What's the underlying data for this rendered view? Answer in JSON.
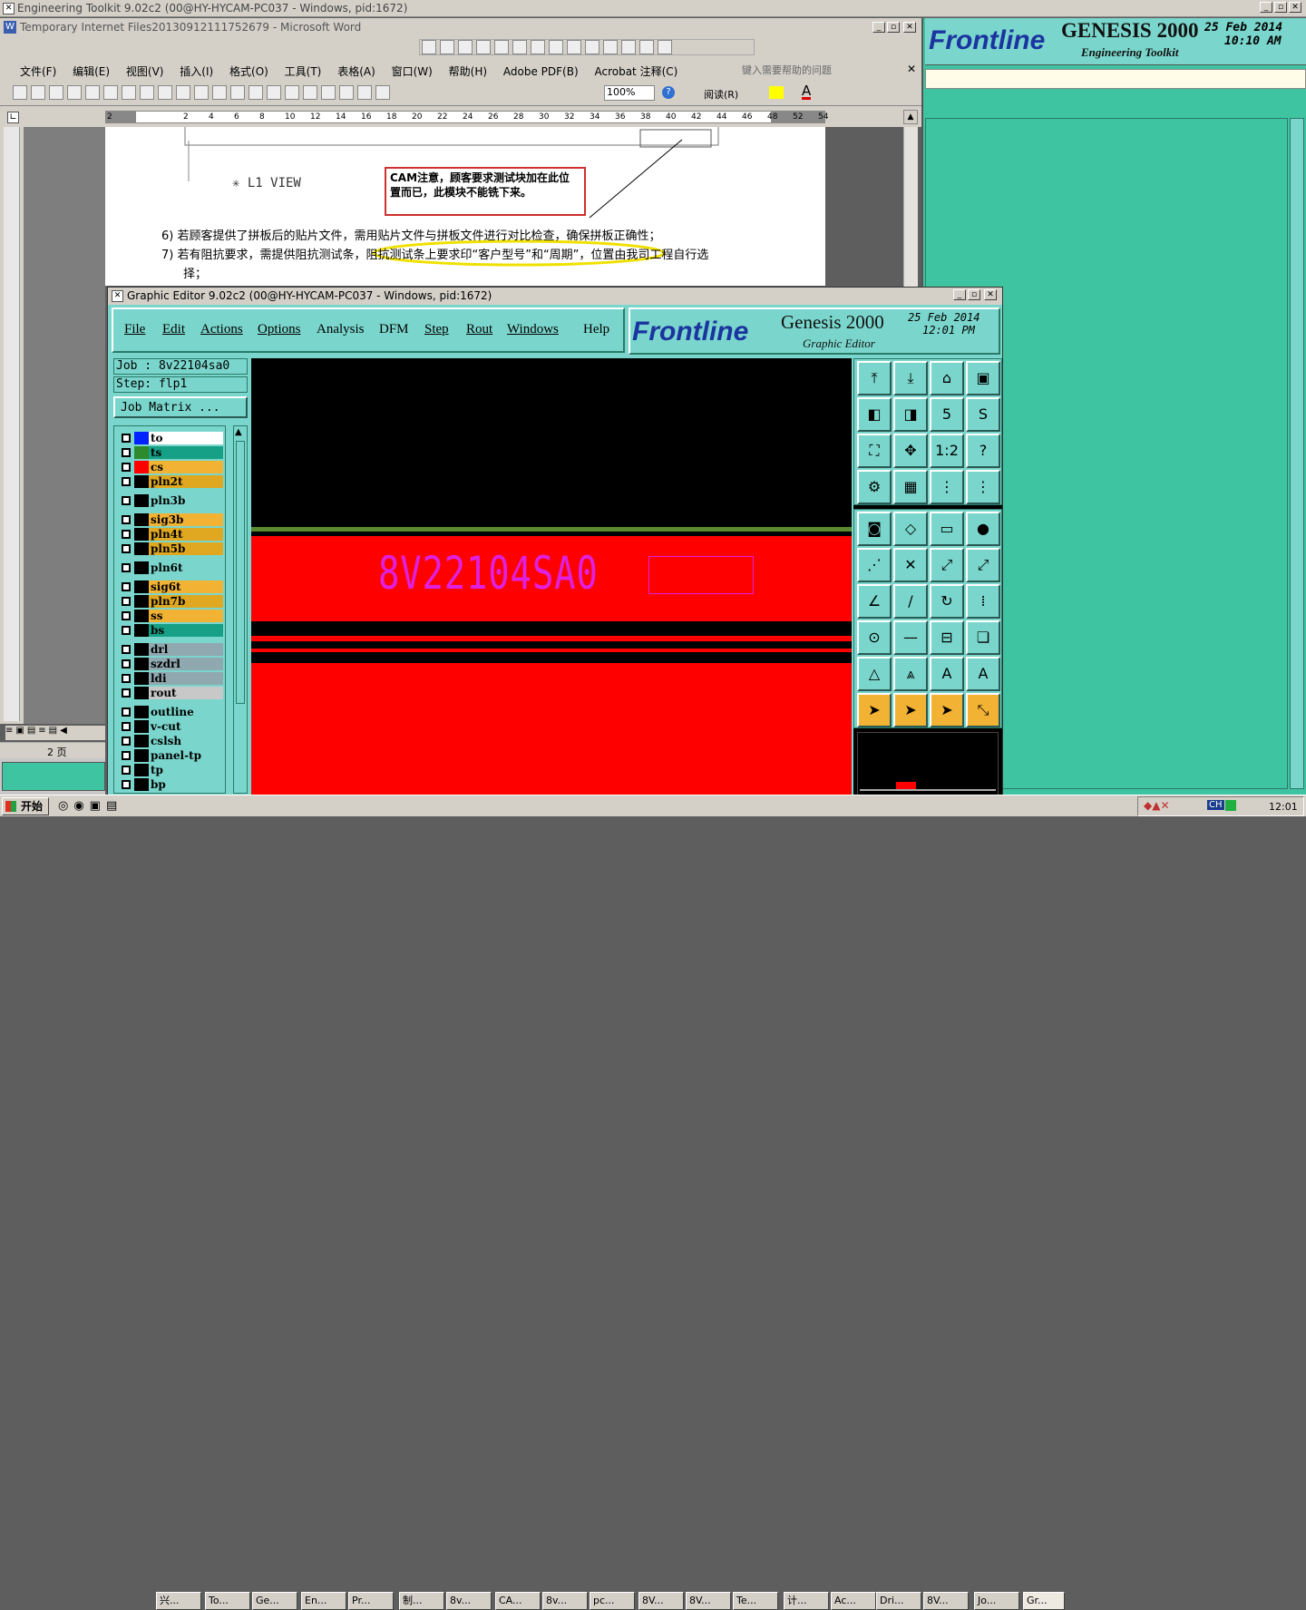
{
  "word": {
    "outer_title": "Engineering Toolkit 9.02c2 (00@HY-HYCAM-PC037 - Windows, pid:1672)",
    "title": "Temporary Internet Files20130912111752679 - Microsoft Word",
    "menus": [
      "文件(F)",
      "编辑(E)",
      "视图(V)",
      "插入(I)",
      "格式(O)",
      "工具(T)",
      "表格(A)",
      "窗口(W)",
      "帮助(H)",
      "Adobe PDF(B)",
      "Acrobat 注释(C)"
    ],
    "help_placeholder": "键入需要帮助的问题",
    "zoom": "100%",
    "read_label": "阅读(R)",
    "ruler": [
      "2",
      "2",
      "4",
      "6",
      "8",
      "10",
      "12",
      "14",
      "16",
      "18",
      "20",
      "22",
      "24",
      "26",
      "28",
      "30",
      "32",
      "34",
      "36",
      "38",
      "40",
      "42",
      "44",
      "46",
      "48",
      "52",
      "54"
    ],
    "l1_view": "✳ L1 VIEW",
    "callout": "CAM注意，顾客要求测试块加在此位置而已，此模块不能铣下来。",
    "item6": "6)  若顾客提供了拼板后的贴片文件，需用贴片文件与拼板文件进行对比检查，确保拼板正确性；",
    "item7a": "7)  若有阻抗要求，需提供阻抗测试条，阻抗测试条上要求印“客户型号”和“周期”，位置由我司工程自行选",
    "item7b": "择；",
    "page_label": "2 页"
  },
  "toolkit": {
    "brand": "Frontline",
    "product": "GENESIS 2000",
    "subtitle": "Engineering Toolkit",
    "date": "25 Feb 2014",
    "time": "10:10 AM"
  },
  "editor": {
    "title": "Graphic Editor 9.02c2 (00@HY-HYCAM-PC037 - Windows, pid:1672)",
    "menus": [
      "File",
      "Edit",
      "Actions",
      "Options",
      "Analysis",
      "DFM",
      "Step",
      "Rout",
      "Windows",
      "Help"
    ],
    "brand": "Frontline",
    "product": "Genesis 2000",
    "subtitle": "Graphic Editor",
    "date": "25 Feb 2014",
    "time": "12:01 PM",
    "job": "Job : 8v22104sa0",
    "step": "Step: flp1",
    "job_matrix": "Job Matrix ...",
    "board_text": "8V22104SA0",
    "layers": [
      {
        "name": "to",
        "color": "#0022ff",
        "bg": "#ffffff"
      },
      {
        "name": "ts",
        "color": "#2d8a2d",
        "bg": "#16a085"
      },
      {
        "name": "cs",
        "color": "#ff0000",
        "bg": "#f2b233"
      },
      {
        "name": "pln2t",
        "color": "#000000",
        "bg": "#e0a820"
      },
      {
        "name": "pln3b",
        "color": "#000000",
        "bg": "#7ad6cc"
      },
      {
        "name": "sig3b",
        "color": "#000000",
        "bg": "#f2b233"
      },
      {
        "name": "pln4t",
        "color": "#000000",
        "bg": "#e0a820"
      },
      {
        "name": "pln5b",
        "color": "#000000",
        "bg": "#e0a820"
      },
      {
        "name": "pln6t",
        "color": "#000000",
        "bg": "#7ad6cc"
      },
      {
        "name": "sig6t",
        "color": "#000000",
        "bg": "#f2b233"
      },
      {
        "name": "pln7b",
        "color": "#000000",
        "bg": "#e0a820"
      },
      {
        "name": "ss",
        "color": "#000000",
        "bg": "#f2b233"
      },
      {
        "name": "bs",
        "color": "#000000",
        "bg": "#16a085"
      },
      {
        "name": "drl",
        "color": "#000000",
        "bg": "#90a8b0"
      },
      {
        "name": "szdrl",
        "color": "#000000",
        "bg": "#90a8b0"
      },
      {
        "name": "ldi",
        "color": "#000000",
        "bg": "#90a8b0"
      },
      {
        "name": "rout",
        "color": "#000000",
        "bg": "#c8c8c8"
      },
      {
        "name": "outline",
        "color": "#000000",
        "bg": "#7ad6cc"
      },
      {
        "name": "v-cut",
        "color": "#000000",
        "bg": "#7ad6cc"
      },
      {
        "name": "cslsh",
        "color": "#000000",
        "bg": "#7ad6cc"
      },
      {
        "name": "panel-tp",
        "color": "#000000",
        "bg": "#7ad6cc"
      },
      {
        "name": "tp",
        "color": "#000000",
        "bg": "#7ad6cc"
      },
      {
        "name": "bp",
        "color": "#000000",
        "bg": "#7ad6cc"
      }
    ],
    "tools_top": [
      "open-icon",
      "save-icon",
      "home-icon",
      "window-icon",
      "left-icon",
      "right-icon",
      "reverse-icon",
      "s-curve-icon",
      "fit-icon",
      "center-icon",
      "one-to-two-icon",
      "help-icon",
      "measure-icon",
      "grid-icon",
      "snap-on-icon",
      "snap-off-icon"
    ],
    "tool_labels_top": [
      "⤒",
      "⤓",
      "⌂",
      "▣",
      "◧",
      "◨",
      "5",
      "S",
      "⛶",
      "✥",
      "1:2",
      "?",
      "⚙",
      "▦",
      "⋮",
      "⋮"
    ],
    "tools_bottom": [
      "feature-icon",
      "polygon-icon",
      "ruler-icon",
      "pad-icon",
      "connect-icon",
      "delete-icon",
      "move-icon",
      "copy-icon",
      "line-icon",
      "slash-icon",
      "arc-icon",
      "split-icon",
      "resize-icon",
      "minus-icon",
      "span-icon",
      "group-icon",
      "triangle1-icon",
      "triangle2-icon",
      "triangle3-icon",
      "triangle4-icon",
      "select-icon",
      "select-box-icon",
      "select-circle-icon",
      "select-route-icon"
    ],
    "tool_labels_bottom": [
      "◙",
      "◇",
      "▭",
      "●",
      "⋰",
      "✕",
      "⤢",
      "⤢",
      "∠",
      "/",
      "↻",
      "⁞",
      "⊙",
      "—",
      "⊟",
      "❏",
      "△",
      "⩓",
      "A",
      "A",
      "➤",
      "➤",
      "➤",
      "⤡"
    ]
  },
  "taskbar": {
    "start": "开始",
    "items": [
      "兴...",
      "To...",
      "Ge...",
      "En...",
      "Pr...",
      "制...",
      "8v...",
      "CA...",
      "8v...",
      "pc...",
      "8V...",
      "8V...",
      "Te...",
      "计...",
      "Ac...",
      "Dri...",
      "8V...",
      "Jo...",
      "Gr..."
    ],
    "clock": "12:01",
    "ime": "CH"
  }
}
